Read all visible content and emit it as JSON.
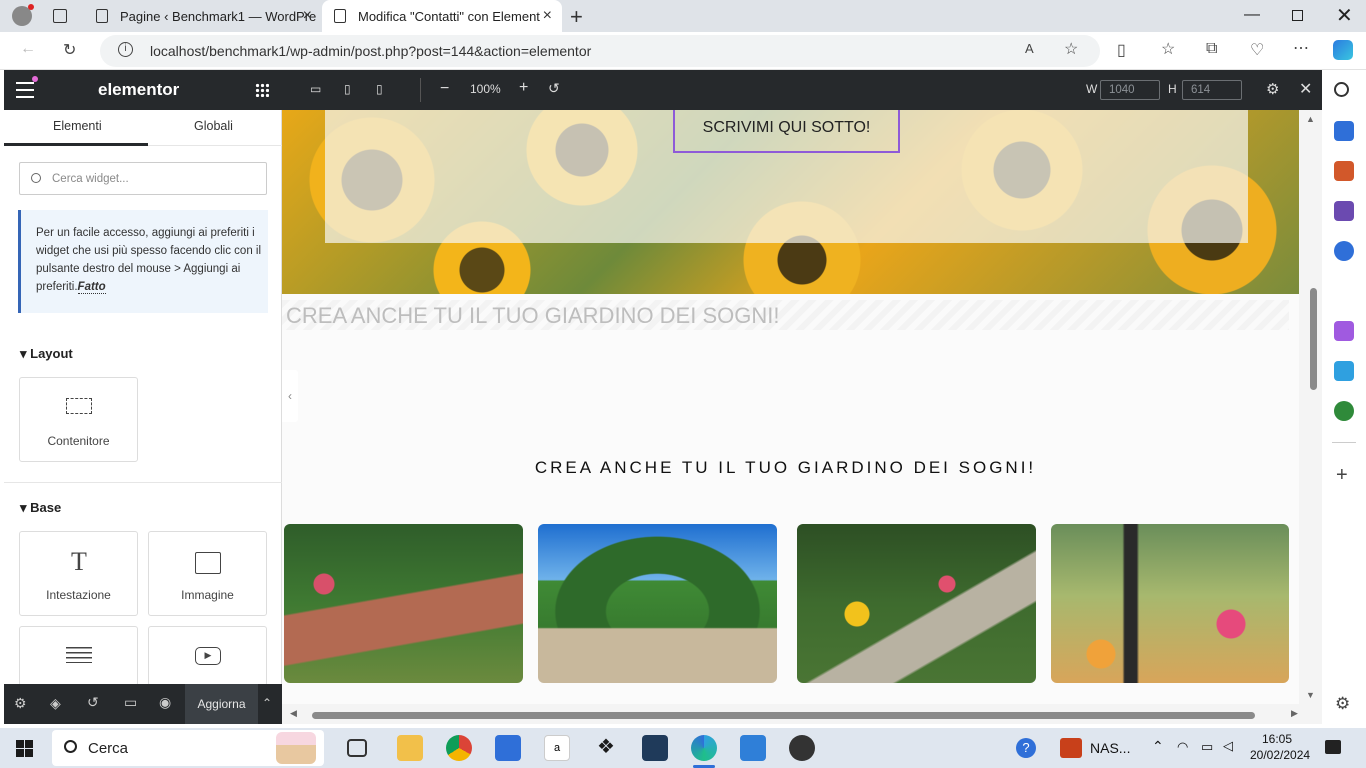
{
  "browser": {
    "tabs": [
      {
        "title": "Pagine ‹ Benchmark1 — WordPre"
      },
      {
        "title": "Modifica \"Contatti\" con Element"
      }
    ],
    "url": "localhost/benchmark1/wp-admin/post.php?post=144&action=elementor"
  },
  "panel": {
    "logo": "elementor",
    "tabs": [
      "Elementi",
      "Globali"
    ],
    "search_placeholder": "Cerca widget...",
    "tip_text": "Per un facile accesso, aggiungi ai preferiti i widget che usi più spesso facendo clic con il pulsante destro del mouse > Aggiungi ai preferiti.",
    "tip_link": "Fatto",
    "sections": [
      {
        "title": "Layout",
        "widgets": [
          "Contenitore"
        ]
      },
      {
        "title": "Base",
        "widgets": [
          "Intestazione",
          "Immagine",
          "",
          ""
        ]
      }
    ],
    "update_label": "Aggiorna"
  },
  "toolbar": {
    "zoom": "100%",
    "w_label": "W",
    "w_value": "1040",
    "h_label": "H",
    "h_value": "614"
  },
  "canvas": {
    "button_text": "SCRIVIMI QUI SOTTO!",
    "faded_heading": "CREA ANCHE TU IL TUO GIARDINO DEI SOGNI!",
    "heading": "CREA ANCHE TU IL TUO GIARDINO DEI SOGNI!"
  },
  "taskbar": {
    "search": "Cerca",
    "nas": "NAS...",
    "time": "16:05",
    "date": "20/02/2024"
  },
  "colors": {
    "panel_dark": "#26292c",
    "accent_purple": "#8e5ad8",
    "tip_border": "#3565b6"
  }
}
